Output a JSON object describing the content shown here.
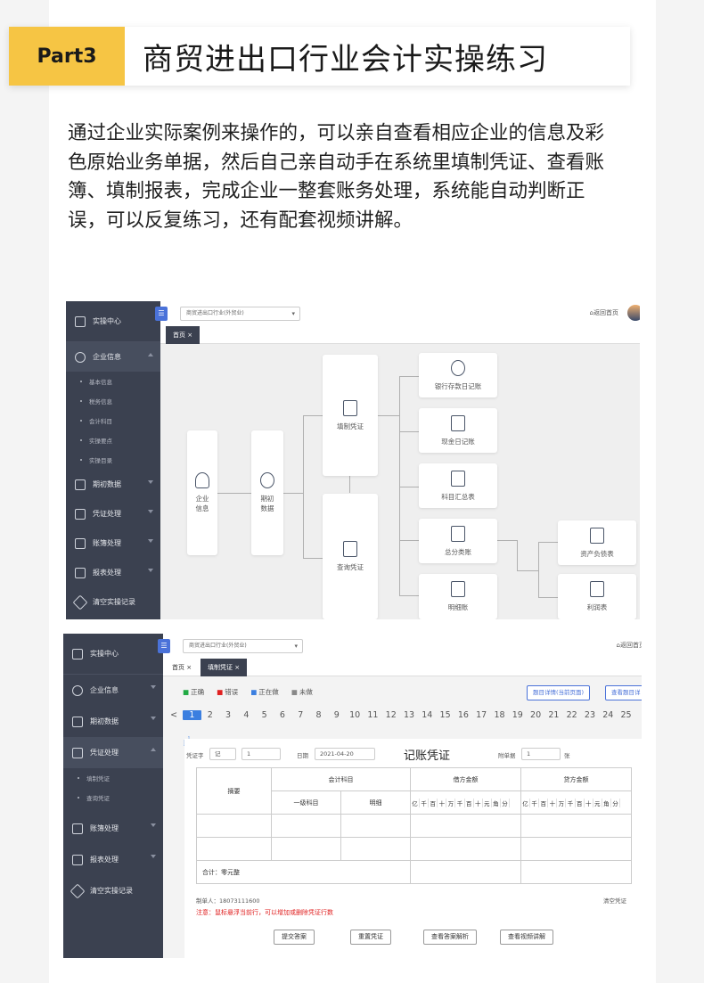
{
  "banner": {
    "badge": "Part3",
    "title": "商贸进出口行业会计实操练习"
  },
  "intro": "通过企业实际案例来操作的，可以亲自查看相应企业的信息及彩色原始业务单据，然后自己亲自动手在系统里填制凭证、查看账簿、填制报表，完成企业一整套账务处理，系统能自动判断正误，可以反复练习，还有配套视频讲解。",
  "screen1": {
    "sidebar": {
      "items": [
        {
          "label": "实操中心",
          "icon": "chart-icon"
        },
        {
          "label": "企业信息",
          "icon": "layers-icon"
        },
        {
          "label": "期初数据",
          "icon": "bar-chart-icon"
        },
        {
          "label": "凭证处理",
          "icon": "voucher-icon"
        },
        {
          "label": "账簿处理",
          "icon": "ledger-icon"
        },
        {
          "label": "报表处理",
          "icon": "line-chart-icon"
        },
        {
          "label": "清空实操记录",
          "icon": "broom-icon"
        }
      ],
      "subitems": [
        "基本信息",
        "税务信息",
        "会计科目",
        "实操要点",
        "实操目录"
      ]
    },
    "company_select": "商贸进出口行业(外贸业)",
    "home_link": "返回首页",
    "tabs": [
      "首页 ×"
    ],
    "flow": {
      "company": "企业\n信息",
      "opening": "期初\n数据",
      "fill": "填制凭证",
      "query": "查询凭证",
      "bank": "银行存款日记账",
      "cash": "现金日记账",
      "summary": "科目汇总表",
      "general": "总分类账",
      "detail": "明细账",
      "balance": "资产负债表",
      "profit": "利润表"
    }
  },
  "screen2": {
    "sidebar": {
      "items": [
        {
          "label": "实操中心",
          "icon": "chart-icon"
        },
        {
          "label": "企业信息",
          "icon": "layers-icon"
        },
        {
          "label": "期初数据",
          "icon": "bar-chart-icon"
        },
        {
          "label": "凭证处理",
          "icon": "voucher-icon"
        },
        {
          "label": "账簿处理",
          "icon": "ledger-icon"
        },
        {
          "label": "报表处理",
          "icon": "line-chart-icon"
        },
        {
          "label": "清空实操记录",
          "icon": "broom-icon"
        }
      ],
      "subitems": [
        "填制凭证",
        "查询凭证"
      ]
    },
    "company_select": "商贸进出口行业(外贸业)",
    "home_link": "返回首页",
    "tabs": [
      "首页 ×",
      "填制凭证 ×"
    ],
    "legend": [
      {
        "label": "正确",
        "color": "#22aa44"
      },
      {
        "label": "错误",
        "color": "#e02020"
      },
      {
        "label": "正在做",
        "color": "#3b7fe0"
      },
      {
        "label": "未做",
        "color": "#888888"
      }
    ],
    "btn_detail": "题目详情(当前页面)",
    "btn_view": "查看题目详",
    "pages": [
      "<",
      "1",
      "2",
      "3",
      "4",
      "5",
      "6",
      "7",
      "8",
      "9",
      "10",
      "11",
      "12",
      "13",
      "14",
      "15",
      "16",
      "17",
      "18",
      "19",
      "20",
      "21",
      "22",
      "23",
      "24",
      "25"
    ],
    "current_page": "1",
    "form": {
      "voucher_word_label": "凭证字",
      "voucher_word": "记",
      "voucher_no": "1",
      "date_label": "日期",
      "date": "2021-04-20",
      "title": "记账凭证",
      "attach_label": "附单据",
      "attach_count": "1",
      "attach_unit": "张",
      "col_summary": "摘要",
      "col_account": "会计科目",
      "col_level1": "一级科目",
      "col_detail": "明细",
      "col_debit": "借方金额",
      "col_credit": "贷方金额",
      "digits": [
        "亿",
        "千",
        "百",
        "十",
        "万",
        "千",
        "百",
        "十",
        "元",
        "角",
        "分"
      ],
      "total": "合计：零元整",
      "maker": "制单人：18073111600",
      "clear": "清空凭证",
      "warning": "注意：鼠标悬浮当前行，可以增加或删除凭证行数",
      "actions": [
        "提交答案",
        "重置凭证",
        "查看答案解析",
        "查看视频讲解"
      ]
    }
  }
}
